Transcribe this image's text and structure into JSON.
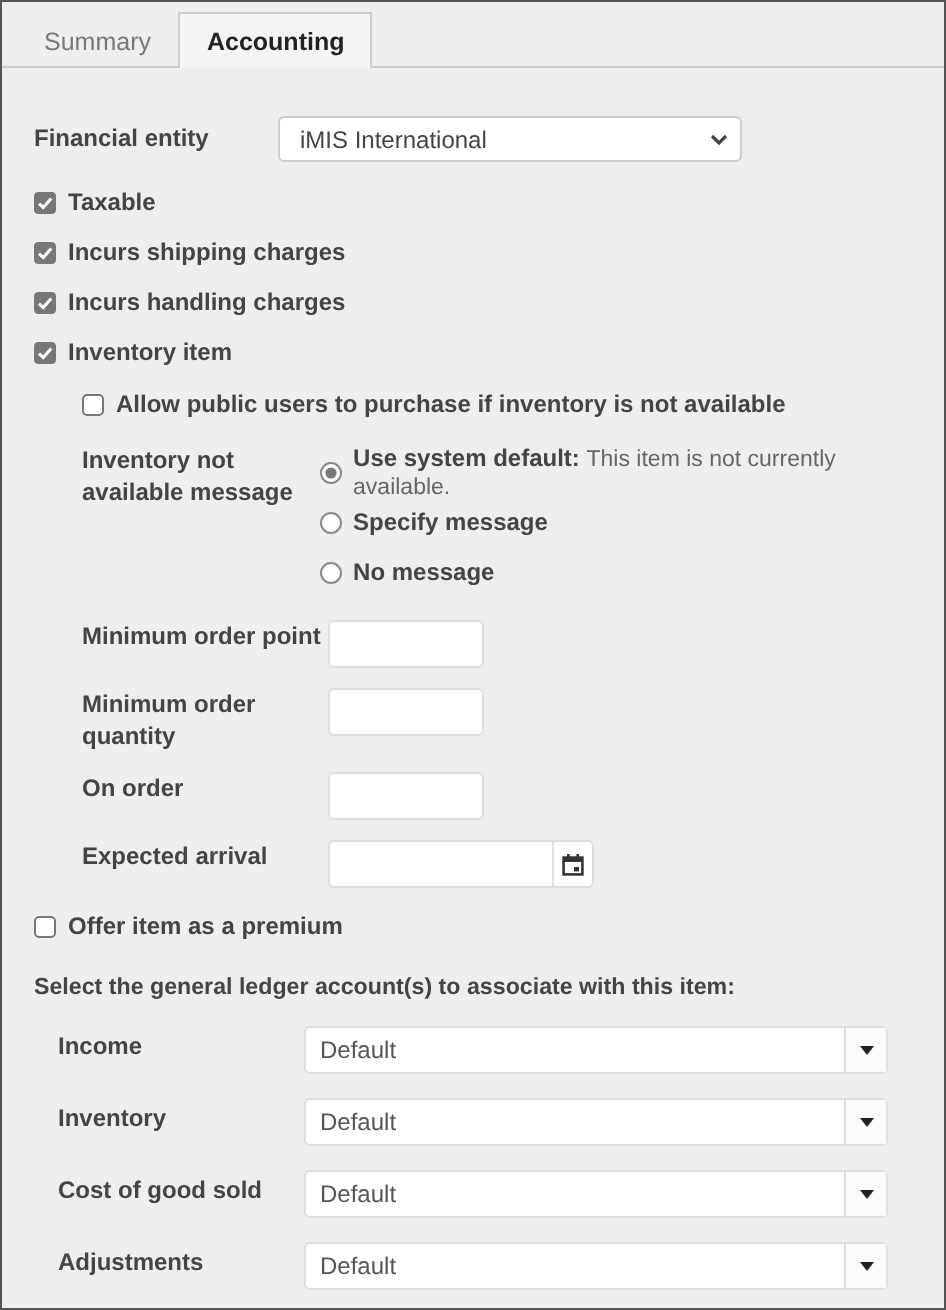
{
  "tabs": [
    {
      "label": "Summary",
      "selected": false
    },
    {
      "label": "Accounting",
      "selected": true
    }
  ],
  "financial_entity": {
    "label": "Financial entity",
    "value": "iMIS International"
  },
  "flags": [
    {
      "label": "Taxable",
      "checked": true
    },
    {
      "label": "Incurs shipping charges",
      "checked": true
    },
    {
      "label": "Incurs handling charges",
      "checked": true
    },
    {
      "label": "Inventory item",
      "checked": true
    }
  ],
  "allow_public": {
    "label": "Allow public users to purchase if inventory is not available",
    "checked": false
  },
  "inventory_message": {
    "label": "Inventory not available message",
    "options": [
      {
        "label": "Use system default:",
        "detail": "This item is not currently available.",
        "selected": true
      },
      {
        "label": "Specify message",
        "selected": false
      },
      {
        "label": "No message",
        "selected": false
      }
    ]
  },
  "stock_fields": [
    {
      "label": "Minimum order point",
      "kind": "text"
    },
    {
      "label": "Minimum order quantity",
      "kind": "text"
    },
    {
      "label": "On order",
      "kind": "text"
    },
    {
      "label": "Expected arrival",
      "kind": "date"
    }
  ],
  "premium": {
    "label": "Offer item as a premium",
    "checked": false
  },
  "gl_prompt": "Select the general ledger account(s) to associate with this item:",
  "gl_accounts": [
    {
      "label": "Income",
      "value": "Default"
    },
    {
      "label": "Inventory",
      "value": "Default"
    },
    {
      "label": "Cost of good sold",
      "value": "Default"
    },
    {
      "label": "Adjustments",
      "value": "Default"
    }
  ]
}
